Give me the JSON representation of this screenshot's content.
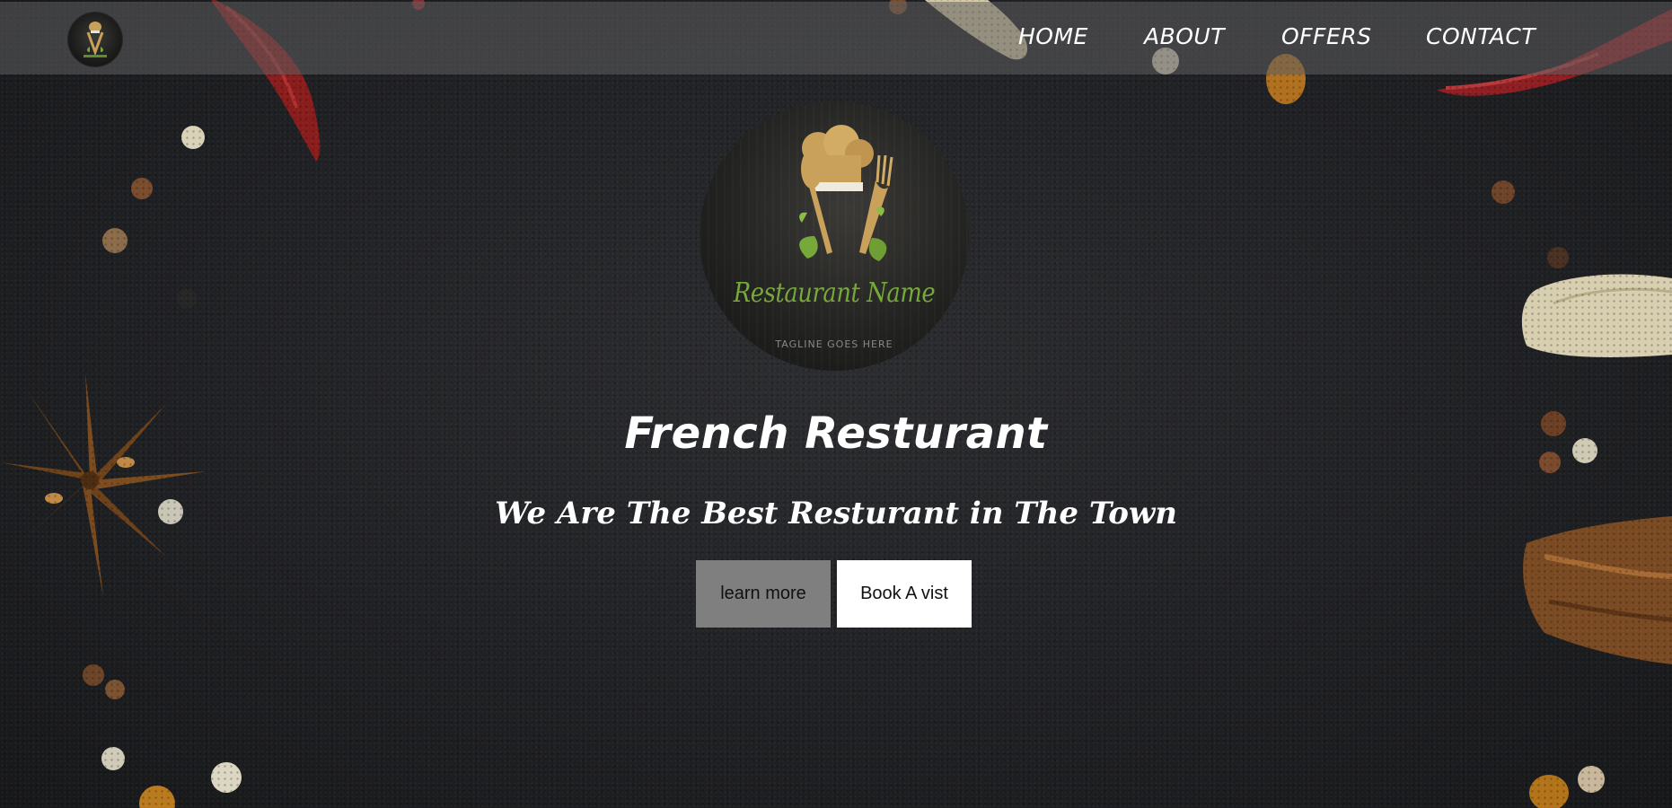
{
  "navbar": {
    "links": [
      {
        "label": "HOME"
      },
      {
        "label": "ABOUT"
      },
      {
        "label": "OFFERS"
      },
      {
        "label": "CONTACT"
      }
    ]
  },
  "hero": {
    "logo": {
      "name": "Restaurant Name",
      "tagline": "TAGLINE GOES HERE"
    },
    "title": "French Resturant",
    "subtitle": "We Are The Best Resturant in The Town",
    "buttons": {
      "learn_more": "learn more",
      "book_visit": "Book A vist"
    }
  },
  "colors": {
    "background": "#232427",
    "navbar": "#5f5f61",
    "learn_button": "#7f7f7f",
    "book_button": "#ffffff",
    "logo_gold": "#c9a15b",
    "logo_green": "#76a83a"
  }
}
